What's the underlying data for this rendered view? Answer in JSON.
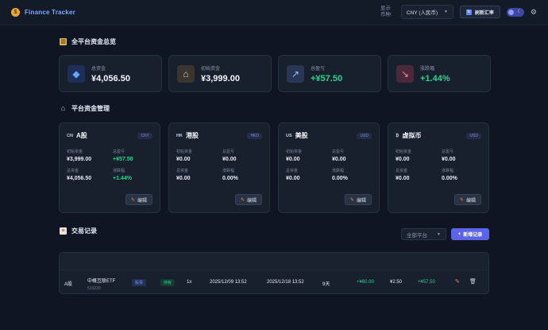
{
  "app": {
    "title": "Finance Tracker"
  },
  "topbar": {
    "currency_label": "显示币种:",
    "currency_value": "CNY (人民币)",
    "refresh_label": "刷新汇率"
  },
  "overview": {
    "title": "全平台资金总览",
    "cards": [
      {
        "label": "总资金",
        "value": "¥4,056.50",
        "icon": "diamond-icon"
      },
      {
        "label": "初始资金",
        "value": "¥3,999.00",
        "icon": "bank-icon"
      },
      {
        "label": "总盈亏",
        "value": "+¥57.50",
        "icon": "chart-up-icon"
      },
      {
        "label": "涨跌幅",
        "value": "+1.44%",
        "icon": "chart-down-icon"
      }
    ]
  },
  "platforms": {
    "title": "平台资金管理",
    "edit_label": "编辑",
    "keys": {
      "initial": "初始资金",
      "pnl": "总盈亏",
      "total": "总资金",
      "change": "涨跌幅"
    },
    "cards": [
      {
        "flag": "CN",
        "name": "A股",
        "currency": "CNY",
        "initial": "¥3,999.00",
        "pnl": "+¥57.50",
        "total": "¥4,056.50",
        "change": "+1.44%"
      },
      {
        "flag": "HK",
        "name": "港股",
        "currency": "HKD",
        "initial": "¥0.00",
        "pnl": "¥0.00",
        "total": "¥0.00",
        "change": "0.00%"
      },
      {
        "flag": "US",
        "name": "美股",
        "currency": "USD",
        "initial": "¥0.00",
        "pnl": "¥0.00",
        "total": "¥0.00",
        "change": "0.00%"
      },
      {
        "flag": "₿",
        "name": "虚拟币",
        "currency": "USD",
        "initial": "¥0.00",
        "pnl": "¥0.00",
        "total": "¥0.00",
        "change": "0.00%"
      }
    ]
  },
  "transactions": {
    "title": "交易记录",
    "filter_value": "全部平台",
    "add_label": "新增记录",
    "rows": [
      {
        "platform": "A股",
        "name": "中概互联ETF",
        "code": "513220",
        "type": "股票",
        "status": "持有",
        "leverage": "1x",
        "open_time": "2025/12/09 13:52",
        "close_time": "2025/12/18 13:52",
        "days": "9天",
        "profit": "+¥60.00",
        "fee": "¥2.50",
        "net": "+¥57.50"
      }
    ]
  }
}
